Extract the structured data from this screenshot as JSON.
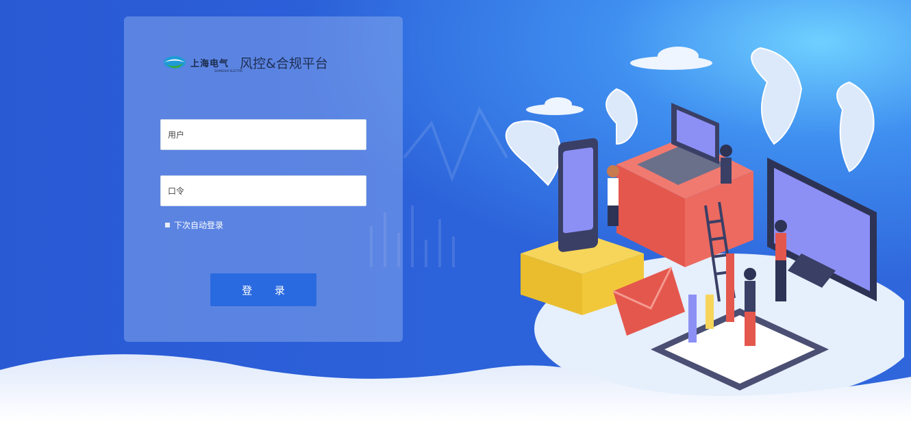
{
  "brand": {
    "logo_text": "上海电气",
    "logo_subtext": "SHANGHAI ELECTRIC",
    "app_title": "风控&合规平台"
  },
  "form": {
    "username_placeholder": "用户",
    "password_placeholder": "口令",
    "remember_label": "下次自动登录",
    "login_label": "登 录"
  },
  "colors": {
    "background": "#2a5fd6",
    "button": "#2a6ae0",
    "card": "rgba(150,180,240,0.45)"
  }
}
